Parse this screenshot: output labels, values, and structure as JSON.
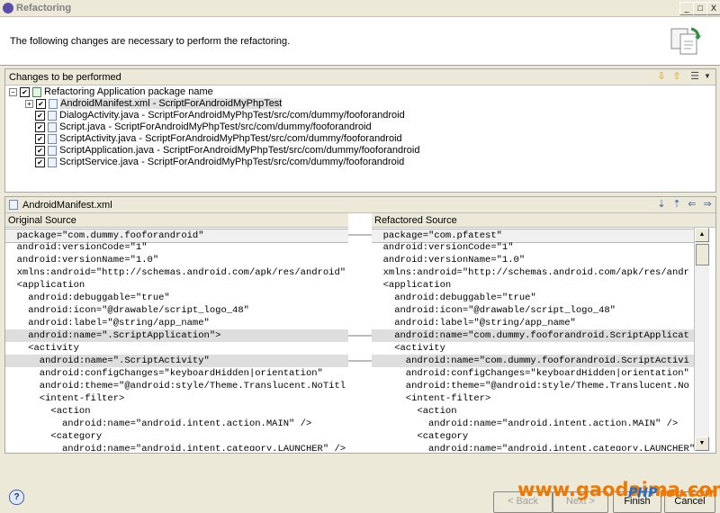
{
  "window": {
    "title": "Refactoring",
    "controls": {
      "minimize": "_",
      "maximize": "□",
      "close": "X"
    }
  },
  "banner": {
    "message": "The following changes are necessary to perform the refactoring."
  },
  "changes_panel": {
    "label": "Changes to be performed",
    "toolbar_icons": [
      "next-change-icon",
      "previous-change-icon",
      "filter-icon",
      "menu-dropdown-icon"
    ],
    "root": {
      "label": "Refactoring Application package name",
      "checked": true,
      "expanded": true
    },
    "items": [
      {
        "label": "AndroidManifest.xml - ScriptForAndroidMyPhpTest",
        "checked": true,
        "selected": true,
        "expandable": true
      },
      {
        "label": "DialogActivity.java - ScriptForAndroidMyPhpTest/src/com/dummy/fooforandroid",
        "checked": true
      },
      {
        "label": "Script.java - ScriptForAndroidMyPhpTest/src/com/dummy/fooforandroid",
        "checked": true
      },
      {
        "label": "ScriptActivity.java - ScriptForAndroidMyPhpTest/src/com/dummy/fooforandroid",
        "checked": true
      },
      {
        "label": "ScriptApplication.java - ScriptForAndroidMyPhpTest/src/com/dummy/fooforandroid",
        "checked": true
      },
      {
        "label": "ScriptService.java - ScriptForAndroidMyPhpTest/src/com/dummy/fooforandroid",
        "checked": true
      }
    ]
  },
  "preview": {
    "file_label": "AndroidManifest.xml",
    "toolbar_icons": [
      "next-difference-icon",
      "previous-difference-icon",
      "copy-left-icon",
      "copy-right-icon"
    ],
    "original_header": "Original Source",
    "refactored_header": "Refactored Source",
    "original_lines": [
      "  package=\"com.dummy.fooforandroid\"",
      "  android:versionCode=\"1\"",
      "  android:versionName=\"1.0\"",
      "  xmlns:android=\"http://schemas.android.com/apk/res/android\"",
      "  <application",
      "    android:debuggable=\"true\"",
      "    android:icon=\"@drawable/script_logo_48\"",
      "    android:label=\"@string/app_name\"",
      "    android:name=\".ScriptApplication\">",
      "    <activity",
      "      android:name=\".ScriptActivity\"",
      "      android:configChanges=\"keyboardHidden|orientation\"",
      "      android:theme=\"@android:style/Theme.Translucent.NoTitl",
      "      <intent-filter>",
      "        <action",
      "          android:name=\"android.intent.action.MAIN\" />",
      "        <category",
      "          android:name=\"android.intent.category.LAUNCHER\" />"
    ],
    "refactored_lines": [
      "  package=\"com.pfatest\"",
      "  android:versionCode=\"1\"",
      "  android:versionName=\"1.0\"",
      "  xmlns:android=\"http://schemas.android.com/apk/res/andr",
      "  <application",
      "    android:debuggable=\"true\"",
      "    android:icon=\"@drawable/script_logo_48\"",
      "    android:label=\"@string/app_name\"",
      "    android:name=\"com.dummy.fooforandroid.ScriptApplicat",
      "    <activity",
      "      android:name=\"com.dummy.fooforandroid.ScriptActivi",
      "      android:configChanges=\"keyboardHidden|orientation\"",
      "      android:theme=\"@android:style/Theme.Translucent.No",
      "      <intent-filter>",
      "        <action",
      "          android:name=\"android.intent.action.MAIN\" />",
      "        <category",
      "          android:name=\"android.intent.category.LAUNCHER\""
    ],
    "changed_line_indices": [
      0,
      8,
      10
    ]
  },
  "buttons": {
    "help": "?",
    "back": "< Back",
    "next": "Next >",
    "finish": "Finish",
    "cancel": "Cancel"
  },
  "watermark": {
    "left": "www.gaodaima.com",
    "right_a": "PHP",
    "right_b": "rou.com"
  },
  "colors": {
    "accent": "#316ac5",
    "watermark_orange": "#f07800",
    "watermark_blue": "#1a6fd0"
  }
}
